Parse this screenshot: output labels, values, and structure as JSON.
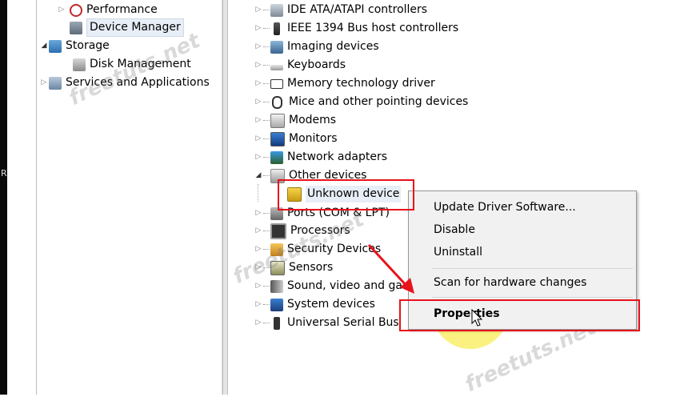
{
  "left_tree": [
    {
      "label": "Performance",
      "icon": "performance-icon",
      "expander": "▷"
    },
    {
      "label": "Device Manager",
      "icon": "device-manager-icon",
      "expander": ""
    },
    {
      "label": "Storage",
      "icon": "storage-icon",
      "expander": "◢"
    },
    {
      "label": "Disk Management",
      "icon": "disk-management-icon",
      "expander": ""
    },
    {
      "label": "Services and Applications",
      "icon": "services-icon",
      "expander": "▷"
    }
  ],
  "left_strip_char": "R",
  "devices": [
    {
      "label": "IDE ATA/ATAPI controllers",
      "icon": "ide-controller-icon",
      "expander": "▷"
    },
    {
      "label": "IEEE 1394 Bus host controllers",
      "icon": "ieee1394-icon",
      "expander": "▷"
    },
    {
      "label": "Imaging devices",
      "icon": "imaging-device-icon",
      "expander": "▷"
    },
    {
      "label": "Keyboards",
      "icon": "keyboard-icon",
      "expander": "▷"
    },
    {
      "label": "Memory technology driver",
      "icon": "memory-icon",
      "expander": "▷"
    },
    {
      "label": "Mice and other pointing devices",
      "icon": "mouse-icon",
      "expander": "▷"
    },
    {
      "label": "Modems",
      "icon": "modem-icon",
      "expander": "▷"
    },
    {
      "label": "Monitors",
      "icon": "monitor-icon",
      "expander": "▷"
    },
    {
      "label": "Network adapters",
      "icon": "network-adapter-icon",
      "expander": "▷"
    },
    {
      "label": "Other devices",
      "icon": "other-devices-icon",
      "expander": "◢"
    },
    {
      "label": "Unknown device",
      "icon": "unknown-device-warning-icon",
      "expander": ""
    },
    {
      "label": "Ports (COM & LPT)",
      "icon": "port-icon",
      "expander": "▷"
    },
    {
      "label": "Processors",
      "icon": "processor-icon",
      "expander": "▷"
    },
    {
      "label": "Security Devices",
      "icon": "security-device-icon",
      "expander": "▷"
    },
    {
      "label": "Sensors",
      "icon": "sensor-icon",
      "expander": "▷"
    },
    {
      "label": "Sound, video and ga",
      "icon": "sound-icon",
      "expander": "▷"
    },
    {
      "label": "System devices",
      "icon": "system-device-icon",
      "expander": "▷"
    },
    {
      "label": "Universal Serial Bus",
      "icon": "usb-icon",
      "expander": "▷"
    }
  ],
  "context_menu": {
    "update": "Update Driver Software...",
    "disable": "Disable",
    "uninstall": "Uninstall",
    "scan": "Scan for hardware changes",
    "properties": "Properties"
  },
  "watermark": "freetuts.net",
  "colors": {
    "annotation_red": "#e8121b",
    "highlight_yellow": "#f8ec50"
  }
}
